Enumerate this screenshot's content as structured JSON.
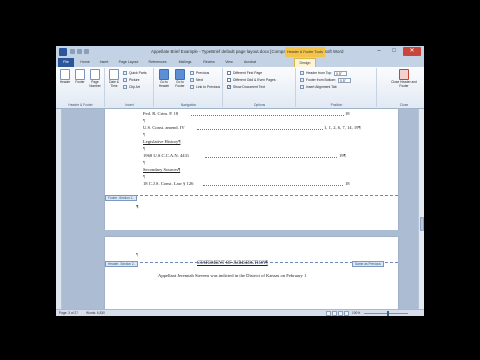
{
  "window": {
    "title": "Appellate Brief Example - TypeBrief default page layout.docx [Compatibility Mode] - Microsoft Word",
    "context_tab": "Header & Footer Tools",
    "controls": {
      "minimize": "–",
      "maximize": "□",
      "close": "✕"
    }
  },
  "tabs": [
    "File",
    "Home",
    "Insert",
    "Page Layout",
    "References",
    "Mailings",
    "Review",
    "View",
    "Acrobat",
    "Design"
  ],
  "active_tab": "Design",
  "ribbon": {
    "header_footer": {
      "label": "Header & Footer",
      "buttons": [
        "Header",
        "Footer",
        "Page Number"
      ]
    },
    "insert": {
      "label": "Insert",
      "big": "Date & Time",
      "small": [
        "Quick Parts",
        "Picture",
        "Clip Art"
      ]
    },
    "navigation": {
      "label": "Navigation",
      "big": [
        "Go to Header",
        "Go to Footer"
      ],
      "small": [
        "Previous",
        "Next",
        "Link to Previous"
      ]
    },
    "options": {
      "label": "Options",
      "checks": [
        {
          "label": "Different First Page",
          "checked": false
        },
        {
          "label": "Different Odd & Even Pages",
          "checked": false
        },
        {
          "label": "Show Document Text",
          "checked": true
        }
      ]
    },
    "position": {
      "label": "Position",
      "rows": [
        {
          "label": "Header from Top:",
          "value": "0.5\""
        },
        {
          "label": "Footer from Bottom:",
          "value": "0.5\""
        },
        {
          "label": "Insert Alignment Tab",
          "value": ""
        }
      ]
    },
    "close": {
      "label": "Close",
      "button": "Close Header and Footer"
    }
  },
  "document": {
    "page1_lines": [
      {
        "text": "Fed. R. Crim. P. 18",
        "page_no": "18"
      },
      {
        "text": "U.S. Const. amend. IV",
        "page_no": "1, 1, 2, 6, 7, 14, 19¶"
      }
    ],
    "legislative_heading": "Legislative History¶",
    "legislative_line": {
      "text": "1968 U.S.C.C.A.N. 4431",
      "page_no": "19¶"
    },
    "secondary_heading": "Secondary Sources¶",
    "secondary_line": {
      "text": "18 C.J.S. Const. Law § 126",
      "page_no": "18"
    },
    "footer_tag": "Footer -Section 1-",
    "footer_pilcrow": "¶",
    "page2_pilcrow": "¶",
    "header_tag": "Header -Section 2-",
    "same_as_previous": "Same as Previous",
    "page2_heading": "STATEMENT OF JURISDICTION¶",
    "page2_body": "Appellant Jeremiah Stevens was indicted in the District of Kansas on February 1",
    "pilcrow": "¶"
  },
  "statusbar": {
    "page": "Page: 3 of 27",
    "words": "Words: 6,830",
    "zoom": "100%"
  }
}
